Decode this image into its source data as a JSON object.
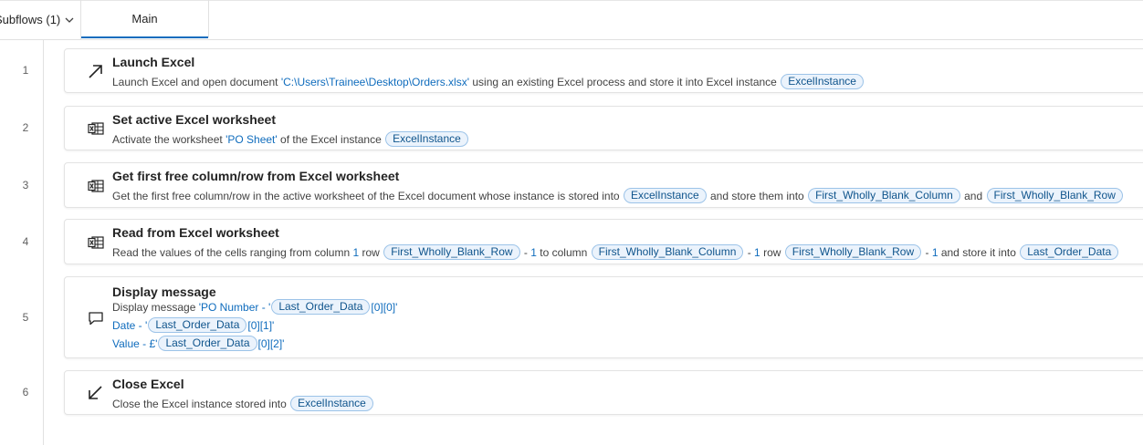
{
  "tabs": {
    "subflows_label": "Subflows (1)",
    "main_label": "Main"
  },
  "steps": [
    {
      "number": "1",
      "title": "Launch Excel",
      "desc": {
        "t1": "Launch Excel and open document ",
        "v1": "'C:\\Users\\Trainee\\Desktop\\Orders.xlsx'",
        "t2": " using an existing Excel process and store it into Excel instance ",
        "p1": "ExcelInstance"
      }
    },
    {
      "number": "2",
      "title": "Set active Excel worksheet",
      "desc": {
        "t1": "Activate the worksheet ",
        "v1": "'PO Sheet'",
        "t2": " of the Excel instance ",
        "p1": "ExcelInstance"
      }
    },
    {
      "number": "3",
      "title": "Get first free column/row from Excel worksheet",
      "desc": {
        "t1": "Get the first free column/row in the active worksheet of the Excel document whose instance is stored into ",
        "p1": "ExcelInstance",
        "t2": " and store them into ",
        "p2": "First_Wholly_Blank_Column",
        "t3": " and ",
        "p3": "First_Wholly_Blank_Row"
      }
    },
    {
      "number": "4",
      "title": "Read from Excel worksheet",
      "desc": {
        "t1": "Read the values of the cells ranging from column ",
        "v1": "1",
        "t2": " row ",
        "p1": "First_Wholly_Blank_Row",
        "t3": " - ",
        "v2": "1",
        "t4": " to column ",
        "p2": "First_Wholly_Blank_Column",
        "t5": " - ",
        "v3": "1",
        "t6": " row ",
        "p3": "First_Wholly_Blank_Row",
        "t7": " - ",
        "v4": "1",
        "t8": " and store it into ",
        "p4": "Last_Order_Data"
      }
    },
    {
      "number": "5",
      "title": "Display message",
      "desc": {
        "line1": {
          "t1": "Display message ",
          "v1": "'PO Number - '",
          "p1": "Last_Order_Data",
          "v2": "[0][0]'"
        },
        "line2": {
          "v1": "Date - '",
          "p1": "Last_Order_Data",
          "v2": "[0][1]'"
        },
        "line3": {
          "v1": "Value - £'",
          "p1": "Last_Order_Data",
          "v2": "[0][2]'"
        }
      }
    },
    {
      "number": "6",
      "title": "Close Excel",
      "desc": {
        "t1": "Close the Excel instance stored into ",
        "p1": "ExcelInstance"
      }
    }
  ],
  "icons": {
    "step1": "arrow-up-right-icon",
    "step2": "excel-icon",
    "step3": "excel-icon",
    "step4": "excel-icon",
    "step5": "message-icon",
    "step6": "arrow-down-left-icon"
  },
  "colors": {
    "accent": "#0f6cbd",
    "pill_bg": "#ebf3fc",
    "pill_border": "#9cc3e8"
  }
}
